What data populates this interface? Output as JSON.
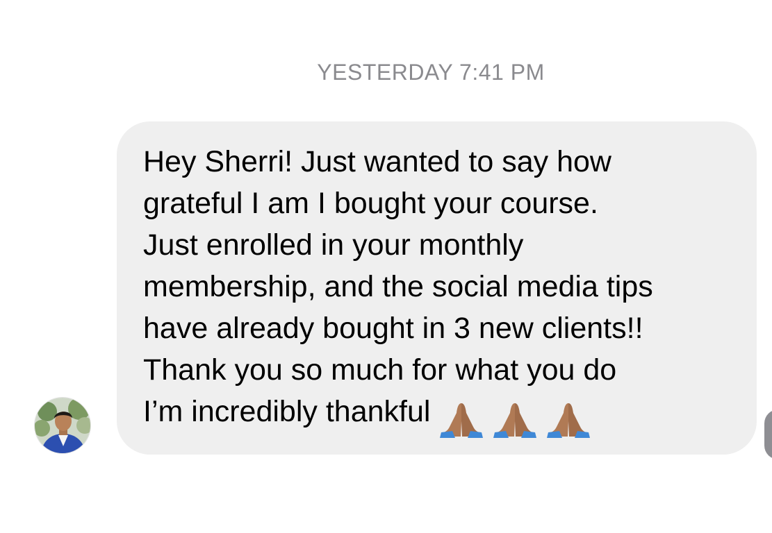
{
  "conversation": {
    "timestamp": "YESTERDAY 7:41 PM"
  },
  "message": {
    "lines": [
      "Hey Sherri! Just wanted to say how",
      "grateful I am I bought your course.",
      "Just enrolled in your monthly",
      "membership, and the social media tips",
      "have already bought in 3 new clients!!",
      "Thank you so much for what you do",
      "I’m incredibly thankful"
    ],
    "emoji": [
      "folded-hands",
      "folded-hands",
      "folded-hands"
    ],
    "bubble_color": "#efefef"
  },
  "sender": {
    "avatar_icon": "profile-photo"
  },
  "colors": {
    "timestamp": "#8a8a8e",
    "text": "#000000",
    "background": "#ffffff"
  }
}
